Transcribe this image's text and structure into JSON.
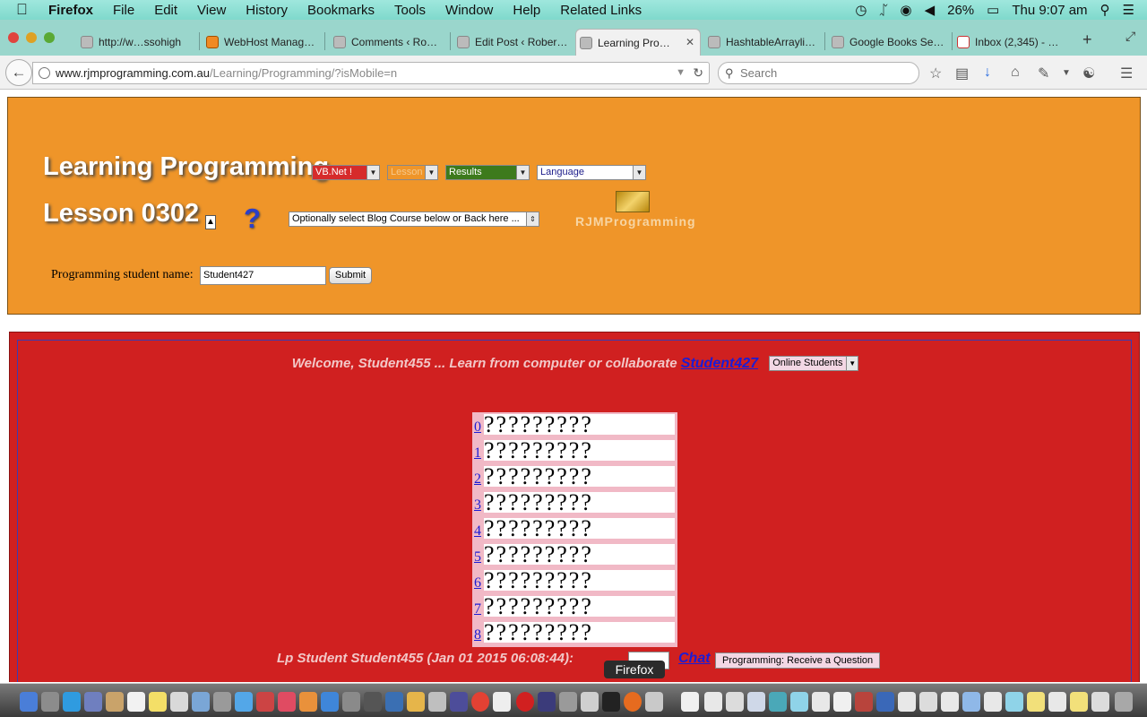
{
  "menubar": {
    "app": "Firefox",
    "items": [
      "File",
      "Edit",
      "View",
      "History",
      "Bookmarks",
      "Tools",
      "Window",
      "Help",
      "Related Links"
    ],
    "battery": "26%",
    "clock": "Thu 9:07 am"
  },
  "tabs": [
    {
      "label": "http://w…ssohigh"
    },
    {
      "label": "WebHost Manag…"
    },
    {
      "label": "Comments ‹ Ro…"
    },
    {
      "label": "Edit Post ‹ Rober…"
    },
    {
      "label": "Learning Pro…"
    },
    {
      "label": "HashtableArrayli…"
    },
    {
      "label": "Google Books Se…"
    },
    {
      "label": "Inbox (2,345) - …"
    }
  ],
  "navbar": {
    "url_host": "www.rjmprogramming.com.au",
    "url_path": "/Learning/Programming/?isMobile=n",
    "search_placeholder": "Search"
  },
  "header": {
    "title": "Learning Programming",
    "lesson": "Lesson 0302",
    "help_mark": "?",
    "selects": {
      "language_course": "VB.Net !",
      "lesson": "Lesson",
      "results": "Results",
      "language": "Language",
      "blog_course": "Optionally select Blog Course below or Back here ..."
    },
    "logo_text": "RJMProgramming",
    "student_label": "Programming student name:",
    "student_value": "Student427",
    "submit_label": "Submit"
  },
  "main": {
    "welcome_prefix": "Welcome, Student455 ... Learn from computer or collaborate",
    "collaborate_link": "Student427",
    "online_students": "Online Students",
    "grid_rows": [
      {
        "num": "0",
        "cells": "?????????"
      },
      {
        "num": "1",
        "cells": "?????????"
      },
      {
        "num": "2",
        "cells": "?????????"
      },
      {
        "num": "3",
        "cells": "?????????"
      },
      {
        "num": "4",
        "cells": "?????????"
      },
      {
        "num": "5",
        "cells": "?????????"
      },
      {
        "num": "6",
        "cells": "?????????"
      },
      {
        "num": "7",
        "cells": "?????????"
      },
      {
        "num": "8",
        "cells": "?????????"
      }
    ],
    "lp_student": "Lp Student Student455 (Jan 01 2015 06:08:44):",
    "chat_link": "Chat",
    "receive_button": "Programming: Receive a Question"
  },
  "tooltip": "Firefox",
  "colors": {
    "orange_panel": "#ef9529",
    "red_panel": "#d02020",
    "link_blue": "#1c1cd4"
  }
}
